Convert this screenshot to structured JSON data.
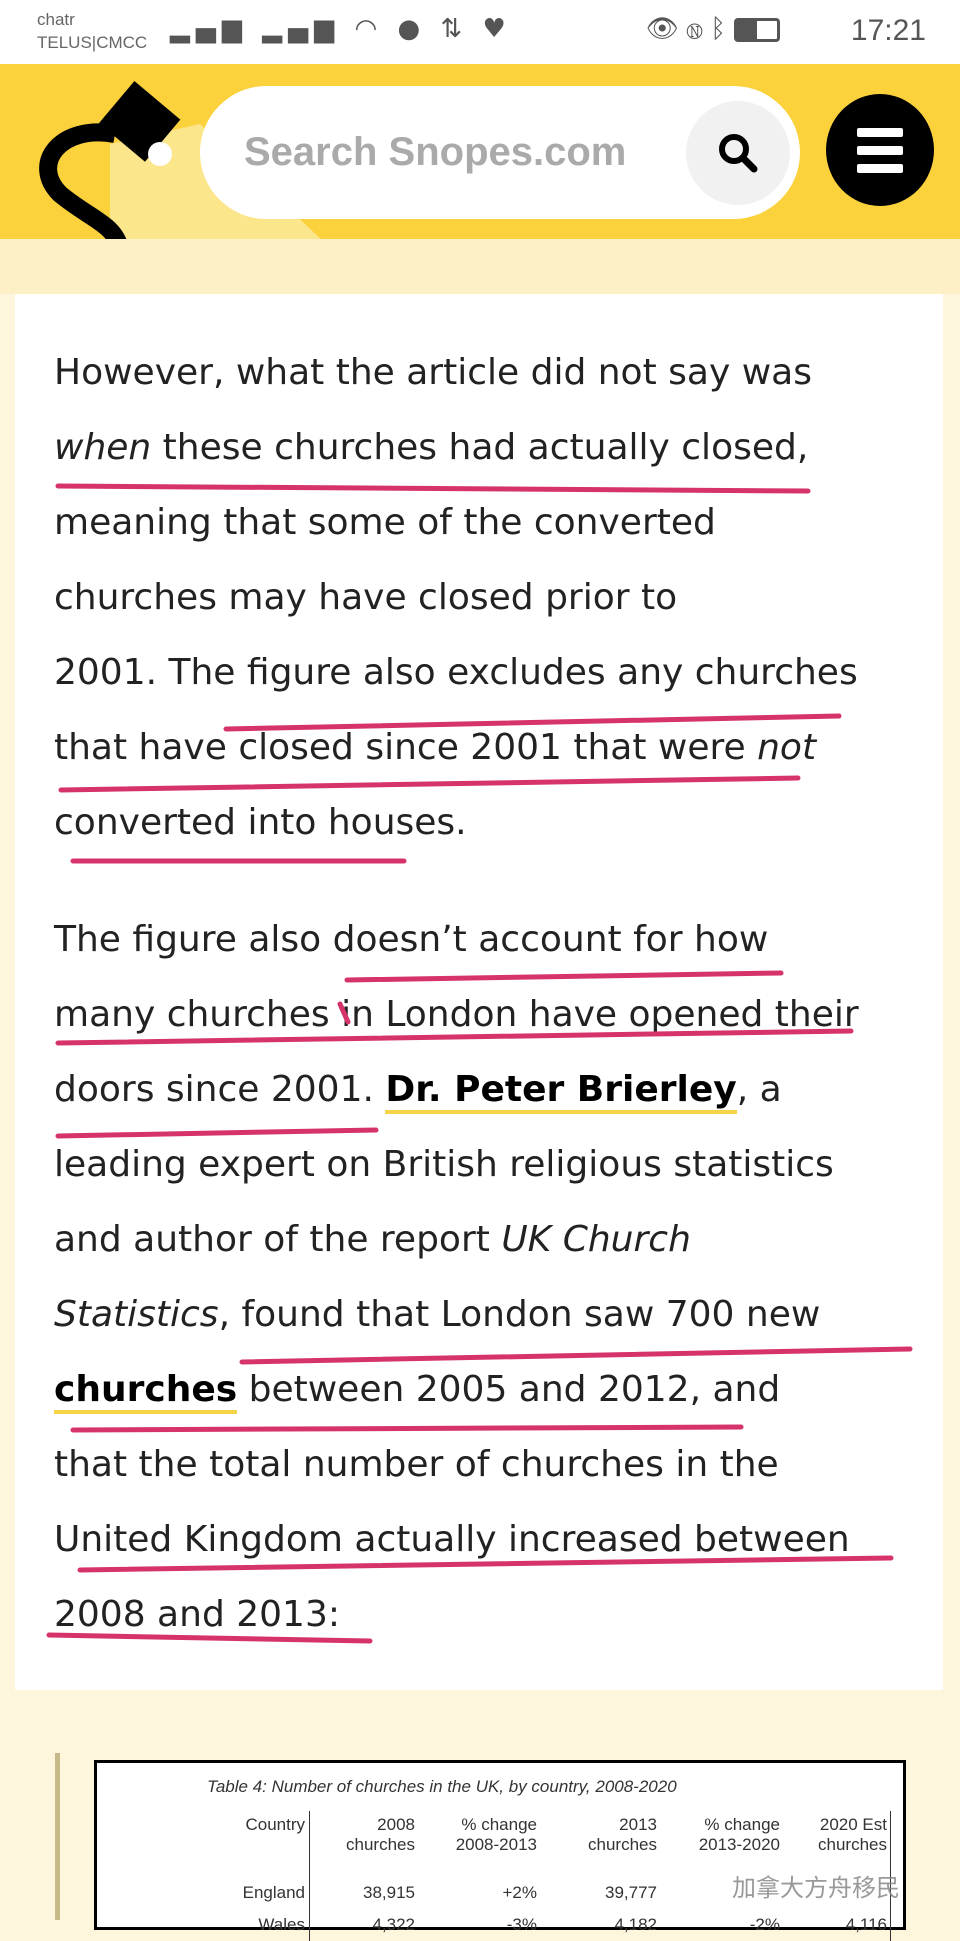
{
  "status_bar": {
    "carrier_1": "chatr",
    "carrier_2": "TELUS|CMCC",
    "left_icons": "3G ▂▄▆ 4G ▂▄▆ wifi wechat sync health",
    "time": "17:21",
    "battery_level": 0.5
  },
  "header": {
    "search_placeholder": "Search Snopes.com",
    "brand_color": "#fbd13c"
  },
  "article": {
    "paragraphs": [
      [
        [
          [
            "However, what the article did not say was",
            ""
          ]
        ],
        [
          [
            "when",
            "it"
          ],
          [
            " these churches had actually closed,",
            ""
          ]
        ],
        [
          [
            "meaning that some of the converted",
            ""
          ]
        ],
        [
          [
            "churches may have closed prior to",
            ""
          ]
        ],
        [
          [
            "2001. The figure also excludes any churches",
            ""
          ]
        ],
        [
          [
            "that have closed since 2001 that were ",
            ""
          ],
          [
            "not",
            "it"
          ]
        ],
        [
          [
            "converted into houses.",
            ""
          ]
        ]
      ],
      [
        [
          [
            "The figure also doesn’t account for how",
            ""
          ]
        ],
        [
          [
            "many churches in London have opened their",
            ""
          ]
        ],
        [
          [
            "doors since 2001. ",
            ""
          ],
          [
            "Dr. Peter Brierley",
            "lk"
          ],
          [
            ", a",
            ""
          ]
        ],
        [
          [
            "leading expert on British religious statistics",
            ""
          ]
        ],
        [
          [
            "and author of the report ",
            ""
          ],
          [
            "UK Church",
            "it"
          ]
        ],
        [
          [
            "Statistics",
            "it"
          ],
          [
            ", found that London saw 700 new",
            ""
          ]
        ],
        [
          [
            "churches",
            "lk"
          ],
          [
            " between 2005 and 2012, and",
            ""
          ]
        ],
        [
          [
            "that the total number of churches in the",
            ""
          ]
        ],
        [
          [
            "United Kingdom actually increased between",
            ""
          ]
        ],
        [
          [
            "2008 and 2013:",
            ""
          ]
        ]
      ]
    ],
    "annotation_color": "#d6336c"
  },
  "table": {
    "caption": "Table 4: Number of churches in the UK, by country, 2008-2020",
    "headers": [
      [
        "Country",
        ""
      ],
      [
        "2008",
        "churches"
      ],
      [
        "% change",
        "2008-2013"
      ],
      [
        "2013",
        "churches"
      ],
      [
        "% change",
        "2013-2020"
      ],
      [
        "2020 Est",
        "churches"
      ]
    ],
    "rows": [
      [
        "England",
        "38,915",
        "+2%",
        "39,777",
        "",
        ""
      ],
      [
        "Wales",
        "4,322",
        "-3%",
        "4,182",
        "-2%",
        "4,116"
      ]
    ]
  },
  "watermark": "加拿大方舟移民"
}
